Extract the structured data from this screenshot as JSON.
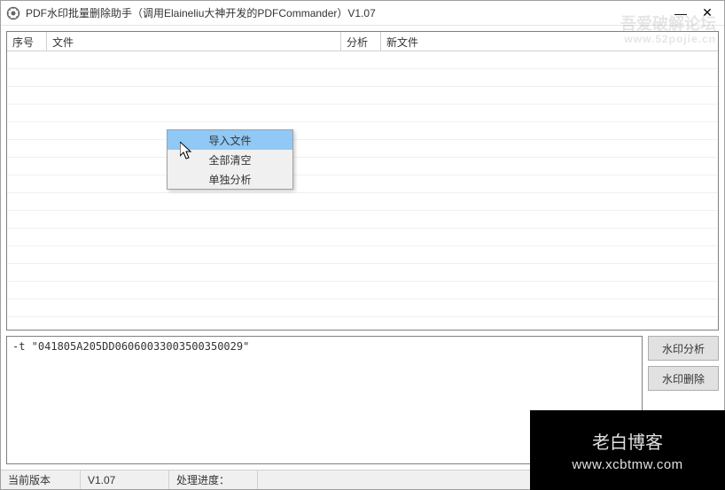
{
  "window": {
    "title": "PDF水印批量删除助手（调用Elaineliu大神开发的PDFCommander）V1.07"
  },
  "grid": {
    "headers": {
      "sno": "序号",
      "file": "文件",
      "analysis": "分析",
      "newfile": "新文件"
    }
  },
  "context_menu": {
    "items": [
      {
        "label": "导入文件",
        "highlighted": true
      },
      {
        "label": "全部清空",
        "highlighted": false
      },
      {
        "label": "单独分析",
        "highlighted": false
      }
    ]
  },
  "command": {
    "text": "-t \"041805A205DD06060033003500350029\""
  },
  "buttons": {
    "analyze": "水印分析",
    "delete": "水印删除"
  },
  "status": {
    "version_label": "当前版本",
    "version": "V1.07",
    "progress_label": "处理进度：",
    "progress": ""
  },
  "watermark_top": {
    "line1": "吾爱破解论坛",
    "line2": "www.52pojie.cn"
  },
  "overlay": {
    "title": "老白博客",
    "url": "www.xcbtmw.com"
  }
}
